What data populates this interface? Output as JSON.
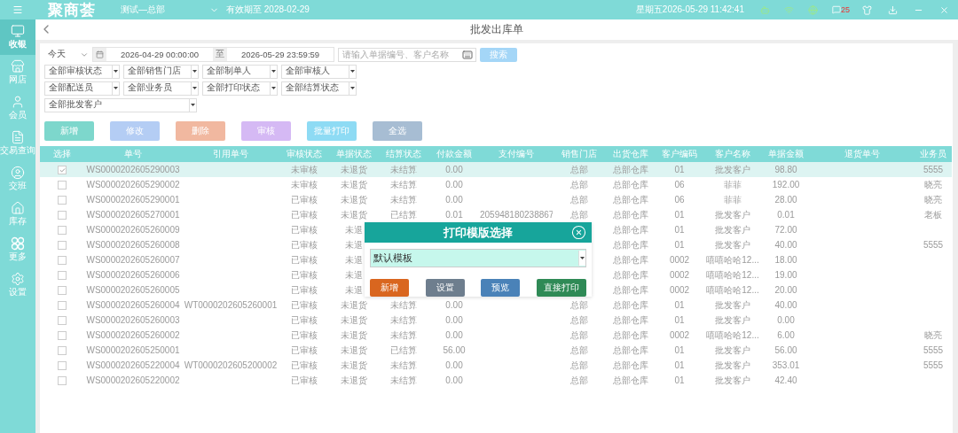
{
  "top_bar": {
    "logo": "聚商荟",
    "store": "测试—总部",
    "valid_until": "有效期至 2028-02-29",
    "clock": "星期五2026-05-29 11:42:41",
    "message_count": "25"
  },
  "sidebar": {
    "items": [
      {
        "label": "收银",
        "selected": true
      },
      {
        "label": "网店",
        "selected": false
      },
      {
        "label": "会员",
        "selected": false
      },
      {
        "label": "交易查询",
        "selected": false
      },
      {
        "label": "交班",
        "selected": false
      },
      {
        "label": "库存",
        "selected": false
      },
      {
        "label": "更多",
        "selected": false
      },
      {
        "label": "设置",
        "selected": false
      }
    ]
  },
  "page_title": "批发出库单",
  "filters": {
    "period": "今天",
    "date_from": "2026-04-29 00:00:00",
    "date_sep": "至",
    "date_to": "2026-05-29 23:59:59",
    "search_placeholder": "请输入单据编号、客户名称",
    "search_button": "搜索",
    "selects": [
      "全部审核状态",
      "全部销售门店",
      "全部制单人",
      "全部审核人",
      "全部配送员",
      "全部业务员",
      "全部打印状态",
      "全部结算状态"
    ],
    "customer_select": "全部批发客户"
  },
  "actions": [
    {
      "label": "新增",
      "color": "#7dd7cc"
    },
    {
      "label": "修改",
      "color": "#b4cdf4"
    },
    {
      "label": "删除",
      "color": "#f1b8a0"
    },
    {
      "label": "审核",
      "color": "#d5b9f4"
    },
    {
      "label": "批量打印",
      "color": "#8edbf4"
    },
    {
      "label": "全选",
      "color": "#a7bdd3"
    }
  ],
  "table": {
    "select_column": "选择",
    "columns": [
      "单号",
      "引用单号",
      "审核状态",
      "单据状态",
      "结算状态",
      "付款金额",
      "支付编号",
      "销售门店",
      "出货仓库",
      "客户编码",
      "客户名称",
      "单据金额",
      "退货单号",
      "业务员"
    ],
    "rows": [
      {
        "selected": true,
        "cells": [
          "WS0000202605290003",
          null,
          "未审核",
          "未退货",
          "未结算",
          "0.00",
          null,
          "总部",
          "总部仓库",
          "01",
          "批发客户",
          "98.80",
          null,
          "5555"
        ]
      },
      {
        "selected": false,
        "cells": [
          "WS0000202605290002",
          null,
          "未审核",
          "未退货",
          "未结算",
          "0.00",
          null,
          "总部",
          "总部仓库",
          "06",
          "菲菲",
          "192.00",
          null,
          "晓亮"
        ]
      },
      {
        "selected": false,
        "cells": [
          "WS0000202605290001",
          null,
          "已审核",
          "未退货",
          "未结算",
          "0.00",
          null,
          "总部",
          "总部仓库",
          "06",
          "菲菲",
          "28.00",
          null,
          "晓亮"
        ]
      },
      {
        "selected": false,
        "cells": [
          "WS0000202605270001",
          null,
          "已审核",
          "未退货",
          "已结算",
          "0.01",
          "205948180238867",
          "总部",
          "总部仓库",
          "01",
          "批发客户",
          "0.01",
          null,
          "老板"
        ]
      },
      {
        "selected": false,
        "cells": [
          "WS0000202605260009",
          null,
          "已审核",
          "未退",
          null,
          null,
          null,
          null,
          "总部仓库",
          "01",
          "批发客户",
          "72.00",
          null,
          null
        ]
      },
      {
        "selected": false,
        "cells": [
          "WS0000202605260008",
          null,
          "已审核",
          "未退",
          null,
          null,
          null,
          null,
          "总部仓库",
          "01",
          "批发客户",
          "40.00",
          null,
          "5555"
        ]
      },
      {
        "selected": false,
        "cells": [
          "WS0000202605260007",
          null,
          "已审核",
          "未退",
          null,
          null,
          null,
          null,
          "总部仓库",
          "0002",
          "嘻嘻哈哈12...",
          "18.00",
          null,
          null
        ]
      },
      {
        "selected": false,
        "cells": [
          "WS0000202605260006",
          null,
          "已审核",
          "未退",
          null,
          null,
          null,
          null,
          "总部仓库",
          "0002",
          "嘻嘻哈哈12...",
          "19.00",
          null,
          null
        ]
      },
      {
        "selected": false,
        "cells": [
          "WS0000202605260005",
          null,
          "已审核",
          "未退",
          null,
          null,
          null,
          null,
          "总部仓库",
          "0002",
          "嘻嘻哈哈12...",
          "20.00",
          null,
          null
        ]
      },
      {
        "selected": false,
        "cells": [
          "WS0000202605260004",
          "WT0000202605260001",
          "已审核",
          "未退货",
          "未结算",
          "0.00",
          null,
          "总部",
          "总部仓库",
          "01",
          "批发客户",
          "40.00",
          null,
          null
        ]
      },
      {
        "selected": false,
        "cells": [
          "WS0000202605260003",
          null,
          "已审核",
          "未退货",
          "未结算",
          "0.00",
          null,
          "总部",
          "总部仓库",
          "01",
          "批发客户",
          "0.00",
          null,
          null
        ]
      },
      {
        "selected": false,
        "cells": [
          "WS0000202605260002",
          null,
          "已审核",
          "未退货",
          "未结算",
          "0.00",
          null,
          "总部",
          "总部仓库",
          "0002",
          "嘻嘻哈哈12...",
          "6.00",
          null,
          "晓亮"
        ]
      },
      {
        "selected": false,
        "cells": [
          "WS0000202605250001",
          null,
          "已审核",
          "未退货",
          "已结算",
          "56.00",
          null,
          "总部",
          "总部仓库",
          "01",
          "批发客户",
          "56.00",
          null,
          "5555"
        ]
      },
      {
        "selected": false,
        "cells": [
          "WS0000202605220004",
          "WT0000202605200002",
          "已审核",
          "未退货",
          "未结算",
          "0.00",
          null,
          "总部",
          "总部仓库",
          "01",
          "批发客户",
          "353.01",
          null,
          "5555"
        ]
      },
      {
        "selected": false,
        "cells": [
          "WS0000202605220002",
          null,
          "已审核",
          "未退货",
          "未结算",
          "0.00",
          null,
          "总部",
          "总部仓库",
          "01",
          "批发客户",
          "42.40",
          null,
          null
        ]
      }
    ]
  },
  "dialog": {
    "title": "打印模版选择",
    "template": "默认模板",
    "buttons": [
      {
        "label": "新增",
        "color": "#d9661f"
      },
      {
        "label": "设置",
        "color": "#6e7e8e"
      },
      {
        "label": "预览",
        "color": "#4a82b8"
      },
      {
        "label": "直接打印",
        "color": "#2f8a56"
      }
    ]
  }
}
